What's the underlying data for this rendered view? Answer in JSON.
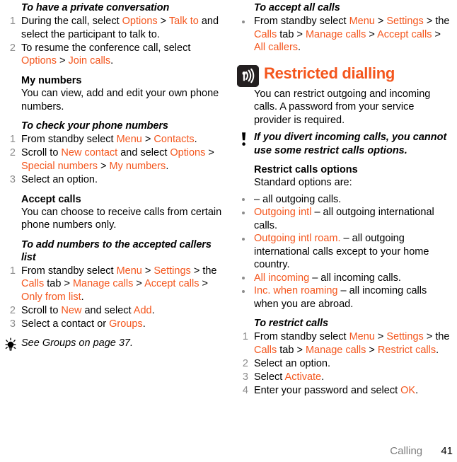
{
  "footer": {
    "chapter": "Calling",
    "page_number": "41"
  },
  "left_column": {
    "proc_private_conversation": {
      "title": "To have a private conversation",
      "steps": [
        {
          "num": "1",
          "parts": [
            {
              "t": "During the call, select ",
              "k": false
            },
            {
              "t": "Options",
              "k": true
            },
            {
              "t": " > ",
              "k": false
            },
            {
              "t": "Talk to",
              "k": true
            },
            {
              "t": " and select the participant to talk to.",
              "k": false
            }
          ]
        },
        {
          "num": "2",
          "parts": [
            {
              "t": "To resume the conference call, select ",
              "k": false
            },
            {
              "t": "Options",
              "k": true
            },
            {
              "t": " > ",
              "k": false
            },
            {
              "t": "Join calls",
              "k": true
            },
            {
              "t": ".",
              "k": false
            }
          ]
        }
      ]
    },
    "my_numbers": {
      "heading": "My numbers",
      "body": "You can view, add and edit your own phone numbers."
    },
    "proc_check_numbers": {
      "title": "To check your phone numbers",
      "steps": [
        {
          "num": "1",
          "parts": [
            {
              "t": "From standby select ",
              "k": false
            },
            {
              "t": "Menu",
              "k": true
            },
            {
              "t": " > ",
              "k": false
            },
            {
              "t": "Contacts",
              "k": true
            },
            {
              "t": ".",
              "k": false
            }
          ]
        },
        {
          "num": "2",
          "parts": [
            {
              "t": "Scroll to ",
              "k": false
            },
            {
              "t": "New contact",
              "k": true
            },
            {
              "t": " and select ",
              "k": false
            },
            {
              "t": "Options",
              "k": true
            },
            {
              "t": " > ",
              "k": false
            },
            {
              "t": "Special numbers",
              "k": true
            },
            {
              "t": " > ",
              "k": false
            },
            {
              "t": "My numbers",
              "k": true
            },
            {
              "t": ".",
              "k": false
            }
          ]
        },
        {
          "num": "3",
          "parts": [
            {
              "t": "Select an option.",
              "k": false
            }
          ]
        }
      ]
    },
    "accept_calls": {
      "heading": "Accept calls",
      "body": "You can choose to receive calls from certain phone numbers only."
    },
    "proc_add_numbers": {
      "title": "To add numbers to the accepted callers list",
      "steps": [
        {
          "num": "1",
          "parts": [
            {
              "t": "From standby select ",
              "k": false
            },
            {
              "t": "Menu",
              "k": true
            },
            {
              "t": " > ",
              "k": false
            },
            {
              "t": "Settings",
              "k": true
            },
            {
              "t": " > the ",
              "k": false
            },
            {
              "t": "Calls",
              "k": true
            },
            {
              "t": " tab > ",
              "k": false
            },
            {
              "t": "Manage calls",
              "k": true
            },
            {
              "t": " > ",
              "k": false
            },
            {
              "t": "Accept calls",
              "k": true
            },
            {
              "t": " > ",
              "k": false
            },
            {
              "t": "Only from list",
              "k": true
            },
            {
              "t": ".",
              "k": false
            }
          ]
        },
        {
          "num": "2",
          "parts": [
            {
              "t": "Scroll to ",
              "k": false
            },
            {
              "t": "New",
              "k": true
            },
            {
              "t": " and select ",
              "k": false
            },
            {
              "t": "Add",
              "k": true
            },
            {
              "t": ".",
              "k": false
            }
          ]
        },
        {
          "num": "3",
          "parts": [
            {
              "t": "Select a contact or ",
              "k": false
            },
            {
              "t": "Groups",
              "k": true
            },
            {
              "t": ".",
              "k": false
            }
          ]
        }
      ]
    },
    "tip": {
      "icon": "lightbulb-icon",
      "text": "See Groups on page 37."
    }
  },
  "right_column": {
    "proc_accept_all": {
      "title": "To accept all calls",
      "bullets": [
        {
          "parts": [
            {
              "t": "From standby select ",
              "k": false
            },
            {
              "t": "Menu",
              "k": true
            },
            {
              "t": " > ",
              "k": false
            },
            {
              "t": "Settings",
              "k": true
            },
            {
              "t": " > the ",
              "k": false
            },
            {
              "t": "Calls",
              "k": true
            },
            {
              "t": " tab > ",
              "k": false
            },
            {
              "t": "Manage calls",
              "k": true
            },
            {
              "t": " > ",
              "k": false
            },
            {
              "t": "Accept calls",
              "k": true
            },
            {
              "t": " > ",
              "k": false
            },
            {
              "t": "All callers",
              "k": true
            },
            {
              "t": ".",
              "k": false
            }
          ]
        }
      ]
    },
    "section": {
      "icon": "signal-waves-icon",
      "title": "Restricted dialling",
      "body": "You can restrict outgoing and incoming calls. A password from your service provider is required."
    },
    "note": {
      "icon": "exclamation-icon",
      "text": "If you divert incoming calls, you cannot use some restrict calls options."
    },
    "restrict_options": {
      "heading": "Restrict calls options",
      "intro": "Standard options are:",
      "bullets": [
        {
          "parts": [
            {
              "t": " ",
              "k": true
            },
            {
              "t": "– all outgoing calls.",
              "k": false
            }
          ]
        },
        {
          "parts": [
            {
              "t": "Outgoing intl",
              "k": true
            },
            {
              "t": " – all outgoing international calls.",
              "k": false
            }
          ]
        },
        {
          "parts": [
            {
              "t": "Outgoing intl roam.",
              "k": true
            },
            {
              "t": " – all outgoing international calls except to your home country.",
              "k": false
            }
          ]
        },
        {
          "parts": [
            {
              "t": "All incoming",
              "k": true
            },
            {
              "t": " – all incoming calls.",
              "k": false
            }
          ]
        },
        {
          "parts": [
            {
              "t": "Inc. when roaming",
              "k": true
            },
            {
              "t": " – all incoming calls when you are abroad.",
              "k": false
            }
          ]
        }
      ]
    },
    "proc_restrict_calls": {
      "title": "To restrict calls",
      "steps": [
        {
          "num": "1",
          "parts": [
            {
              "t": "From standby select ",
              "k": false
            },
            {
              "t": "Menu",
              "k": true
            },
            {
              "t": " > ",
              "k": false
            },
            {
              "t": "Settings",
              "k": true
            },
            {
              "t": " > the ",
              "k": false
            },
            {
              "t": "Calls",
              "k": true
            },
            {
              "t": " tab > ",
              "k": false
            },
            {
              "t": "Manage calls",
              "k": true
            },
            {
              "t": " > ",
              "k": false
            },
            {
              "t": "Restrict calls",
              "k": true
            },
            {
              "t": ".",
              "k": false
            }
          ]
        },
        {
          "num": "2",
          "parts": [
            {
              "t": "Select an option.",
              "k": false
            }
          ]
        },
        {
          "num": "3",
          "parts": [
            {
              "t": "Select ",
              "k": false
            },
            {
              "t": "Activate",
              "k": true
            },
            {
              "t": ".",
              "k": false
            }
          ]
        },
        {
          "num": "4",
          "parts": [
            {
              "t": "Enter your password and select ",
              "k": false
            },
            {
              "t": "OK",
              "k": true
            },
            {
              "t": ".",
              "k": false
            }
          ]
        }
      ]
    }
  },
  "colors": {
    "accent_orange": "#f4561d",
    "number_gray": "#8c8c8c",
    "footer_gray": "#7d7d7d",
    "badge_dark": "#231f20"
  }
}
